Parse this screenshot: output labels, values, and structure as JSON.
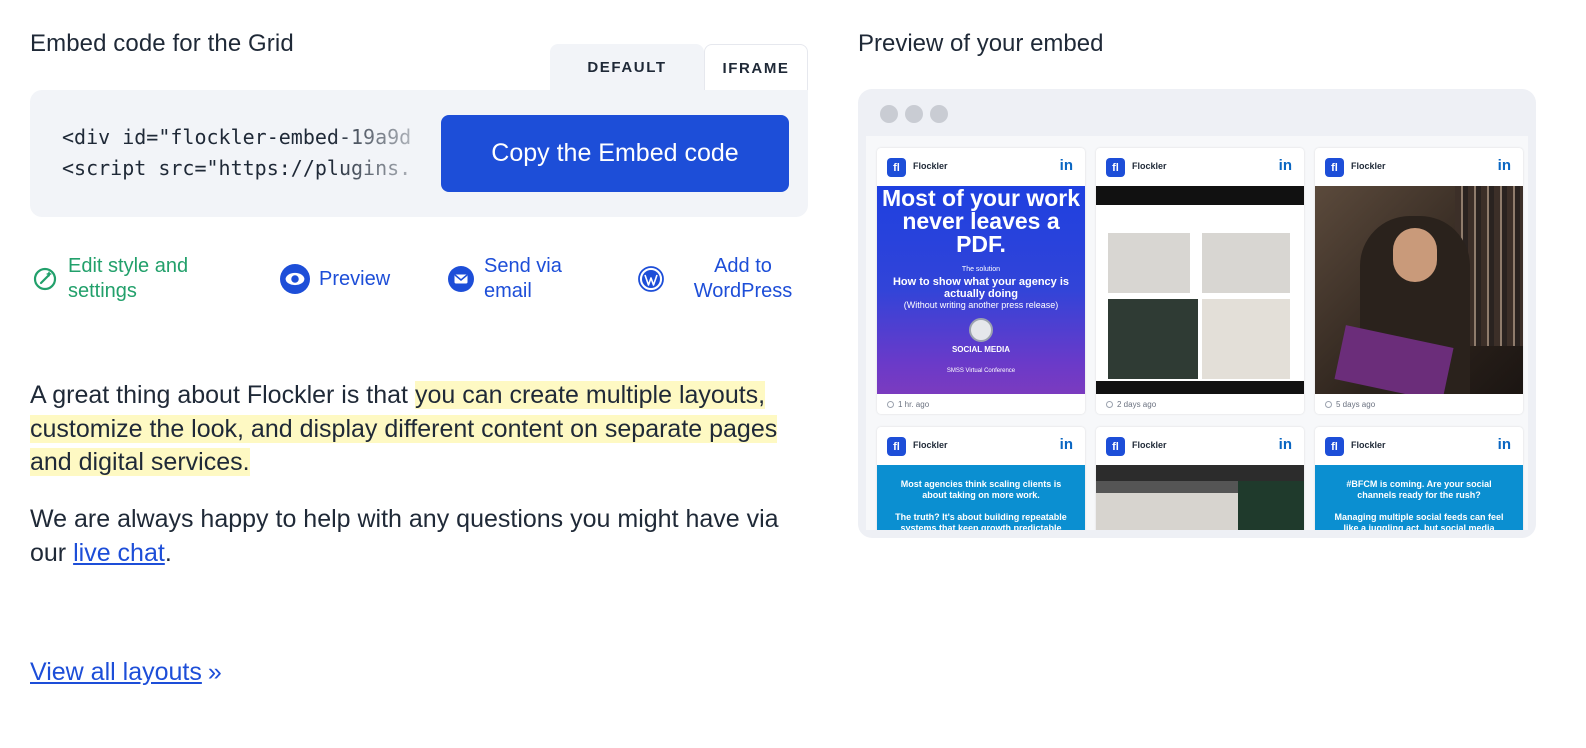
{
  "embed": {
    "title": "Embed code for the Grid",
    "tabs": {
      "default": "DEFAULT",
      "iframe": "IFRAME"
    },
    "code_line_1": "<div id=\"flockler-embed-19a9d",
    "code_line_2": "<script src=\"https://plugins.",
    "copy_button": "Copy the Embed code"
  },
  "actions": {
    "edit": "Edit style and settings",
    "preview": "Preview",
    "email": "Send via email",
    "wordpress": "Add to WordPress"
  },
  "text": {
    "p1_a": "A great thing about Flockler is that ",
    "p1_highlight": "you can create multiple layouts, customize the look, and display different content on separate pages and digital services.",
    "p2_a": "We are always happy to help with any questions you might have via our ",
    "p2_link": "live chat",
    "p2_end": ".",
    "view_all": "View all layouts",
    "view_all_suffix": "»"
  },
  "preview": {
    "title": "Preview of your embed",
    "cards": [
      {
        "brand": "Flockler",
        "network_icon": "in",
        "time": "1 hr. ago",
        "headline": "Most of your work never leaves a PDF.",
        "kicker": "The solution",
        "sub": "How to show what your agency is actually doing",
        "sub2": "(Without writing another press release)",
        "event": "SOCIAL MEDIA",
        "footnote": "SMSS Virtual Conference"
      },
      {
        "brand": "Flockler",
        "network_icon": "in",
        "time": "2 days ago"
      },
      {
        "brand": "Flockler",
        "network_icon": "in",
        "time": "5 days ago"
      },
      {
        "brand": "Flockler",
        "network_icon": "in",
        "text_1": "Most agencies think scaling clients is about taking on more work.",
        "text_2": "The truth? It's about building repeatable systems that keep growth predictable (not"
      },
      {
        "brand": "Flockler",
        "network_icon": "in"
      },
      {
        "brand": "Flockler",
        "network_icon": "in",
        "text_1": "#BFCM is coming. Are your social channels ready for the rush?",
        "text_2": "Managing multiple social feeds can feel like a juggling act, but social media aggregation can"
      }
    ]
  },
  "colors": {
    "primary": "#1d4ed8",
    "green": "#22a06b",
    "highlight": "#fef9c3",
    "linkedin": "#0a66c2"
  }
}
